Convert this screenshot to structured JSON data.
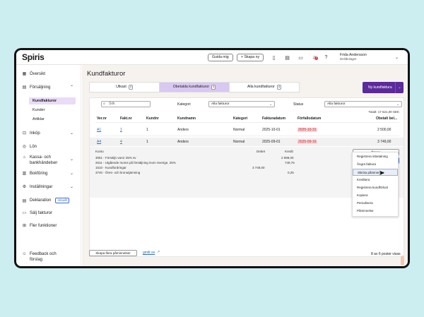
{
  "topbar": {
    "logo": "Spiris",
    "guide_button": "Guida mig",
    "create_button": "+ Skapa ny",
    "notification_count": "2",
    "user_name": "Frida Andersson",
    "company": "Delitbolaget"
  },
  "sidebar": {
    "items": [
      {
        "label": "Översikt",
        "icon": "grid-icon"
      },
      {
        "label": "Försäljning",
        "icon": "sales-icon"
      },
      {
        "label": "Inköp",
        "icon": "cart-icon"
      },
      {
        "label": "Lön",
        "icon": "salary-icon"
      },
      {
        "label": "Kassa- och",
        "label2": "bankhändelser",
        "icon": "bank-icon"
      },
      {
        "label": "Bokföring",
        "icon": "ledger-icon"
      },
      {
        "label": "Inställningar",
        "icon": "settings-icon"
      },
      {
        "label": "Deklaration",
        "icon": "declaration-icon",
        "badge": "Aktuellt"
      },
      {
        "label": "Sälj fakturor",
        "icon": "sell-invoice-icon"
      },
      {
        "label": "Fler funktioner",
        "icon": "more-icon"
      },
      {
        "label": "Feedback och",
        "label2": "förslag",
        "icon": "feedback-icon"
      }
    ],
    "sub_items": [
      "Kundfakturor",
      "Kunder",
      "Artiklar"
    ]
  },
  "main": {
    "title": "Kundfakturor",
    "tabs": [
      {
        "label": "Utkast",
        "count": "4"
      },
      {
        "label": "Obetalda kundfakturor",
        "count": "4"
      },
      {
        "label": "Alla kundfakturor",
        "count": "4"
      }
    ],
    "new_button": "Ny kundfaktura",
    "search_placeholder": "Sök",
    "category_label": "Kategori",
    "category_value": "Alla fakturor",
    "status_label": "Status",
    "status_value": "Alla fakturor",
    "total": "Totalt: 17 621,00 SEK",
    "columns": [
      "Ver.nr",
      "Fakt.nr",
      "Kundnr",
      "Kundnamn",
      "Kategori",
      "Fakturadatum",
      "Förfallodatum",
      "Obetalt bel..."
    ],
    "rows": [
      {
        "ver": "A1",
        "fakt": "1",
        "kund": "1",
        "namn": "Anders",
        "kat": "Normal",
        "datum": "2025-10-01",
        "forfall": "2025-10-31",
        "belopp": "2 500,00"
      },
      {
        "ver": "A4",
        "fakt": "4",
        "kund": "1",
        "namn": "Anders",
        "kat": "Normal",
        "datum": "2025-09-01",
        "forfall": "2025-09-16",
        "belopp": "3 749,00"
      }
    ],
    "detail": {
      "konto_header": "Konto",
      "debet_header": "Debet",
      "kredit_header": "Kredit",
      "lines": [
        {
          "konto": "3051 - Försäljn varor 25% sv",
          "debet": "",
          "kredit": "2 999,00"
        },
        {
          "konto": "2611 - Utgående moms på försäljning inom Sverige, 25%",
          "debet": "",
          "kredit": "749,75"
        },
        {
          "konto": "1510 - Kundfordringar",
          "debet": "3 749,00",
          "kredit": ""
        },
        {
          "konto": "3740 - Öres- och kronutjämning",
          "debet": "",
          "kredit": "0,25"
        }
      ],
      "open_button": "Öppna",
      "actions_button": "Åtgärder"
    },
    "actions_menu": [
      "Registrera inbetalning",
      "Ångra faktura",
      "Skicka påminnelse",
      "Kreditera",
      "Registrera kundförlust",
      "Kopiera",
      "Periodisera",
      "Påminnelse"
    ],
    "footer_button": "Skapa flera påminnelser",
    "footer_link": "gmilt.se",
    "pager": "8 av 6 poster visas"
  },
  "colors": {
    "accent": "#5b2a9b",
    "tab_active": "#d9c8f2",
    "overdue": "#c3282f",
    "background": "#cdeef0"
  }
}
